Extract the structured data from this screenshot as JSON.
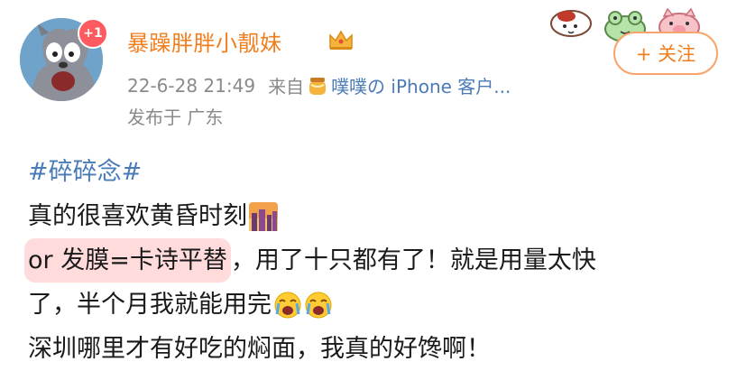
{
  "user": {
    "name": "暴躁胖胖小靓妹",
    "badge": "+1",
    "timestamp": "22-6-28 21:49",
    "source_prefix": "来自",
    "source": "噗噗の iPhone 客户...",
    "location": "发布于 广东"
  },
  "follow": {
    "label": "+ 关注"
  },
  "post": {
    "hashtag": "#碎碎念#",
    "line2": "真的很喜欢黄昏时刻",
    "line3_highlight": "or 发膜=卡诗平替",
    "line3_rest": "，用了十只都有了！就是用量太快",
    "line4": "了，半个月我就能用完",
    "line5": "深圳哪里才有好吃的焖面，我真的好馋啊！"
  },
  "icons": {
    "crown": "crown-icon",
    "source_app": "honey-jar-icon",
    "sunset": "sunset-city-emoji",
    "crying": "crying-face-emoji",
    "decor": [
      "mushroom-sticker-icon",
      "frog-sticker-icon",
      "pig-sticker-icon"
    ]
  },
  "colors": {
    "username": "#f27d1b",
    "link": "#4a7bb7",
    "meta": "#8a8a8a",
    "highlight": "#ffb3b3"
  }
}
